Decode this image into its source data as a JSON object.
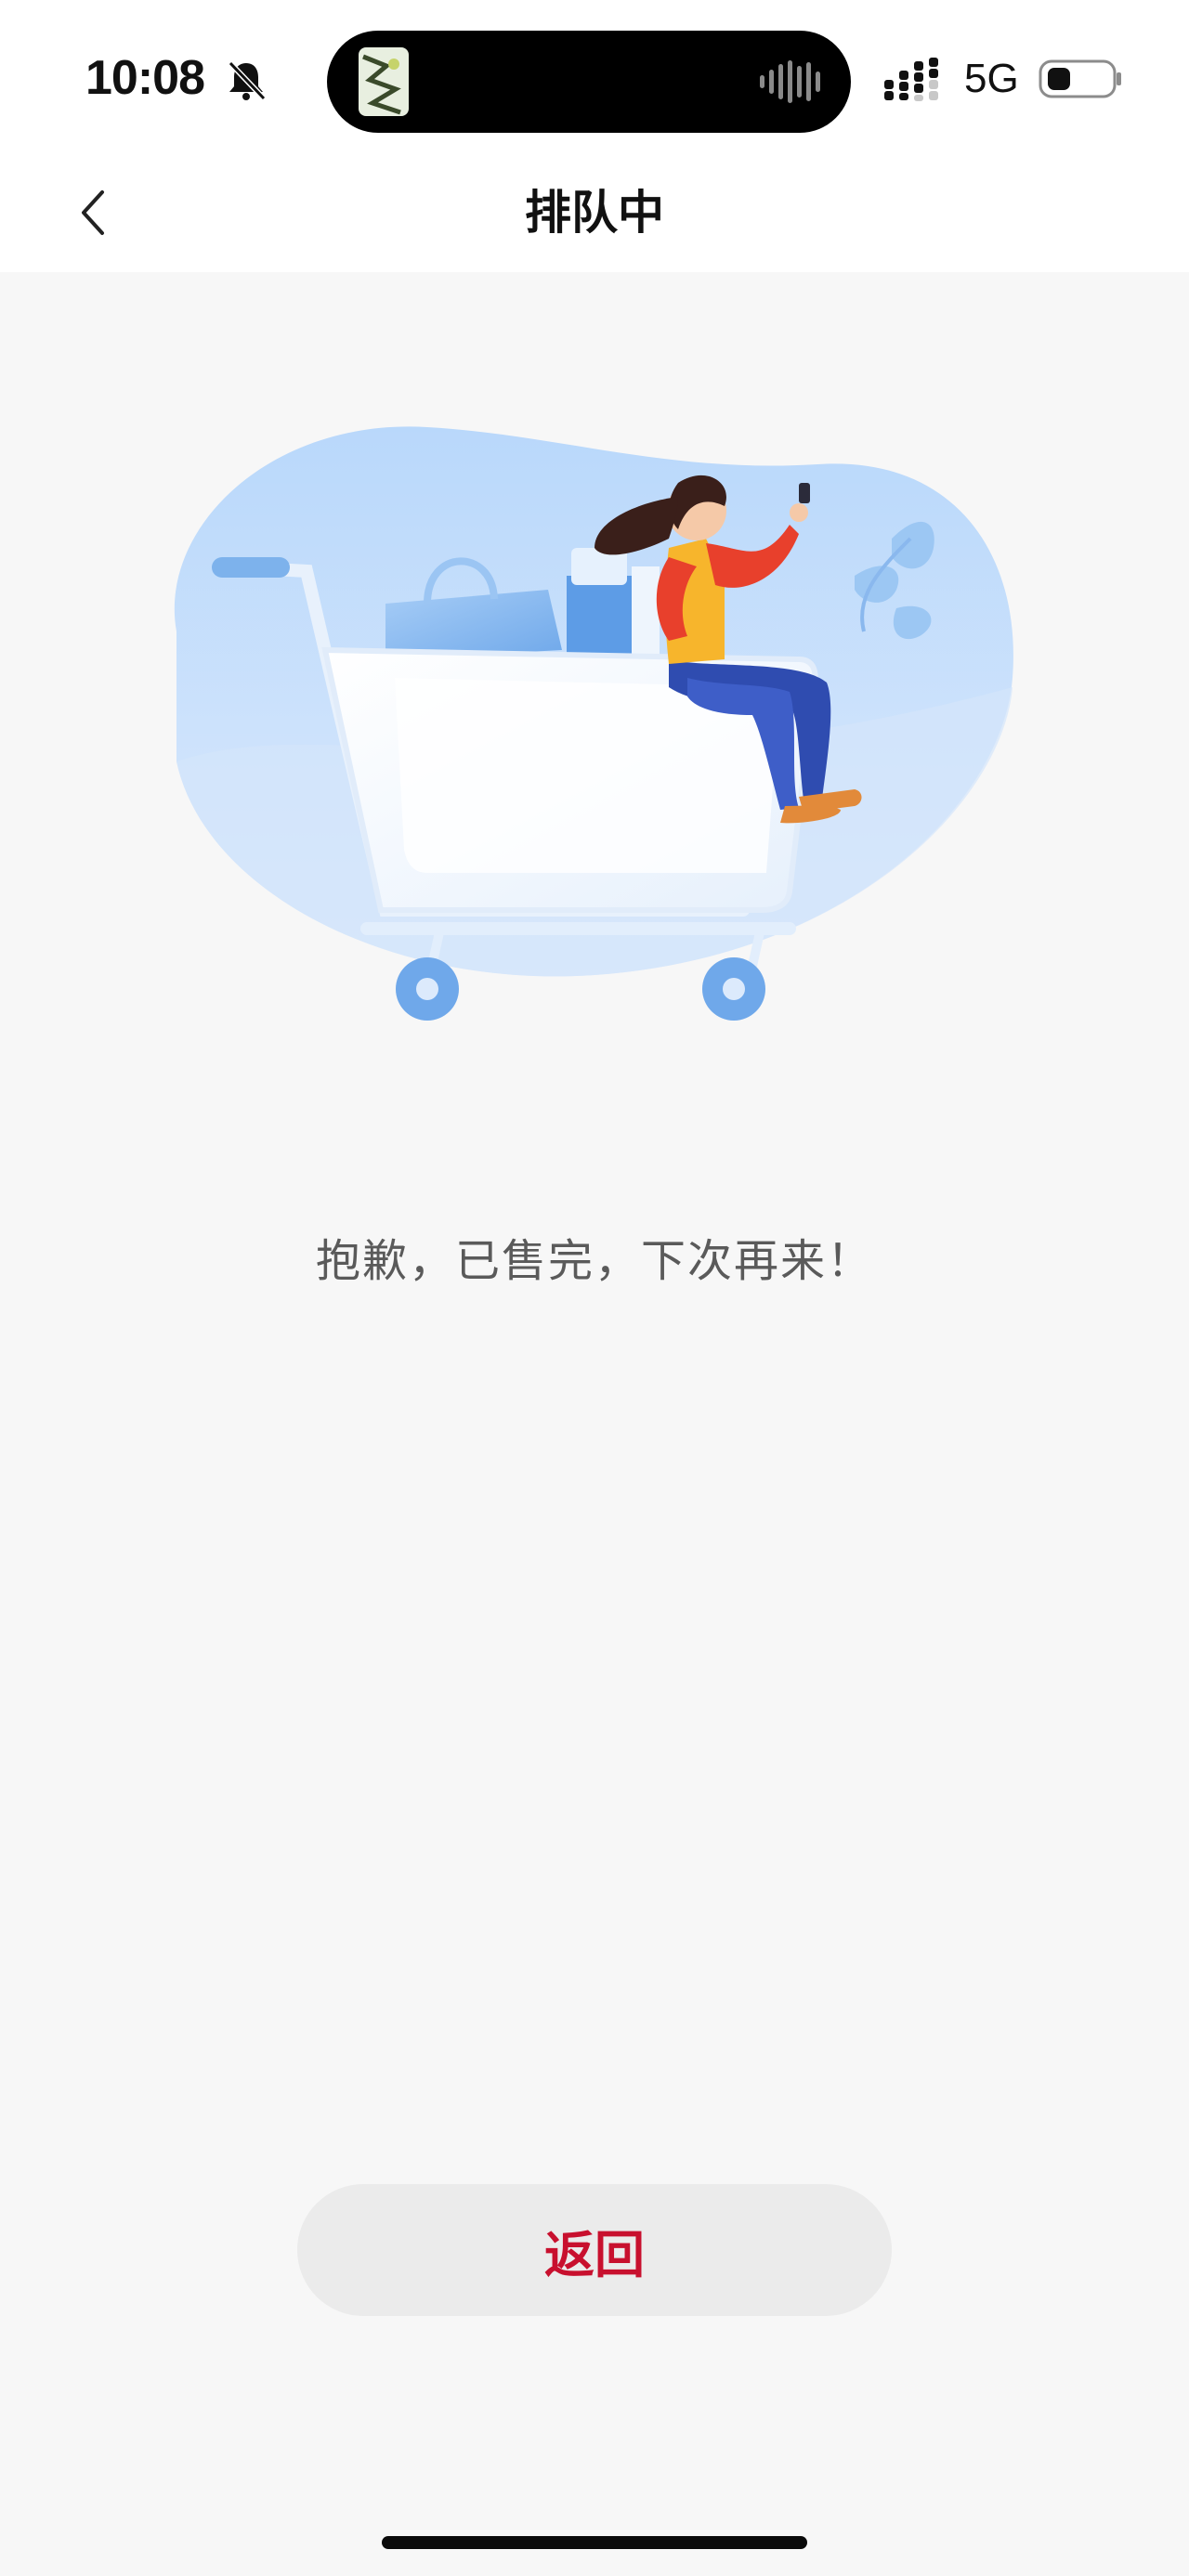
{
  "status_bar": {
    "time": "10:08",
    "network": "5G",
    "icons": [
      "bell-muted-icon",
      "signal-icon",
      "battery-icon",
      "audio-wave-icon"
    ]
  },
  "nav": {
    "title": "排队中",
    "back_icon": "chevron-left-icon"
  },
  "illustration": {
    "description_icon": "shopping-cart-illustration"
  },
  "message": "抱歉，已售完，下次再来！",
  "actions": {
    "return_label": "返回"
  },
  "colors": {
    "accent": "#c8102e",
    "background": "#f7f7f7",
    "button_bg": "#ebebeb"
  }
}
